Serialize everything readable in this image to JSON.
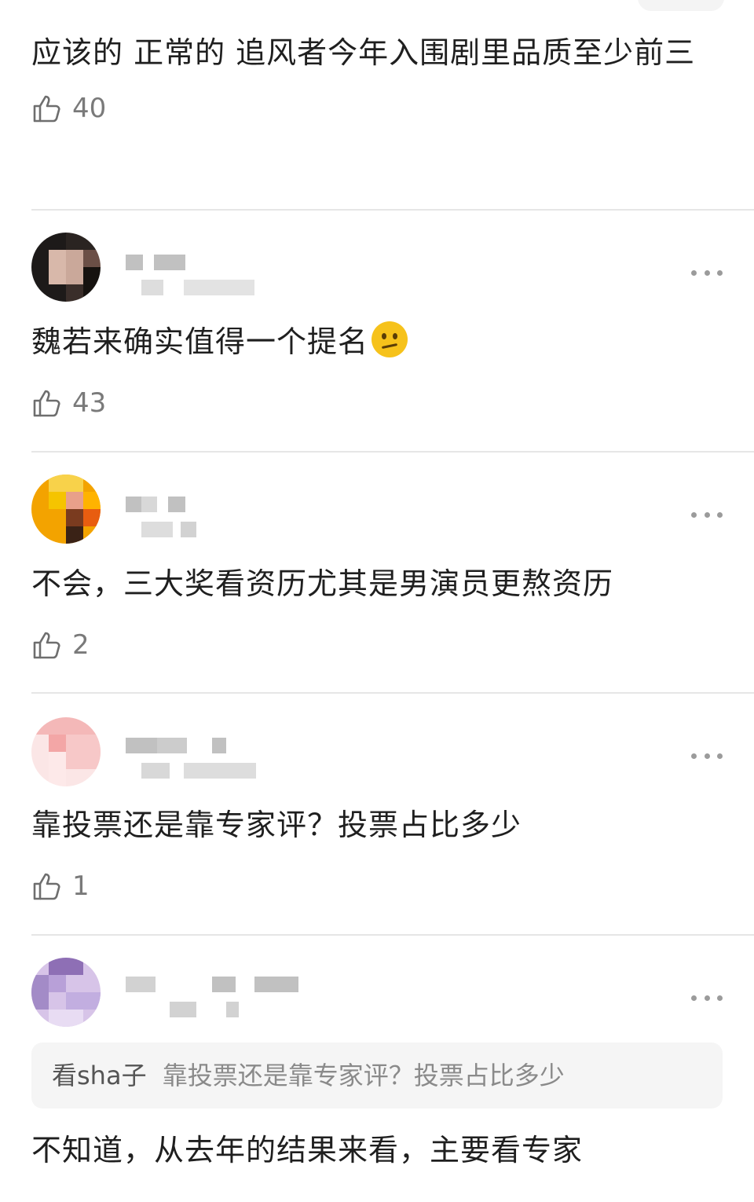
{
  "comments": [
    {
      "text": "应该的 正常的 追风者今年入围剧里品质至少前三",
      "likes": "40"
    },
    {
      "text": "魏若来确实值得一个提名",
      "emoji": "confused-face-emoji",
      "likes": "43",
      "avatar_colors": [
        "#2b2522",
        "#c9a79b",
        "#6b4f46",
        "#1a1614",
        "#d8b8aa",
        "#3a2e2a"
      ]
    },
    {
      "text": "不会，三大奖看资历尤其是男演员更熬资历",
      "likes": "2",
      "avatar_colors": [
        "#f0b400",
        "#ff9a00",
        "#7a3b1f",
        "#f5c400",
        "#e85d10",
        "#3a2216"
      ]
    },
    {
      "text": "靠投票还是靠专家评？投票占比多少",
      "likes": "1",
      "avatar_colors": [
        "#f3a6a6",
        "#fbe2e2",
        "#f7c8c8",
        "#fde9e9",
        "#f09a9a",
        "#ffffff"
      ]
    },
    {
      "text": "不知道，从去年的结果来看，主要看专家",
      "avatar_colors": [
        "#b8a0d8",
        "#8e6fb5",
        "#d7c4e8",
        "#a38bc7",
        "#e8dcf3",
        "#c2aee0"
      ],
      "reply_to": {
        "author": "看sha子",
        "text": "靠投票还是靠专家评？投票占比多少"
      }
    }
  ],
  "icons": {
    "like": "thumbs-up-icon",
    "more": "more-dots-icon"
  }
}
